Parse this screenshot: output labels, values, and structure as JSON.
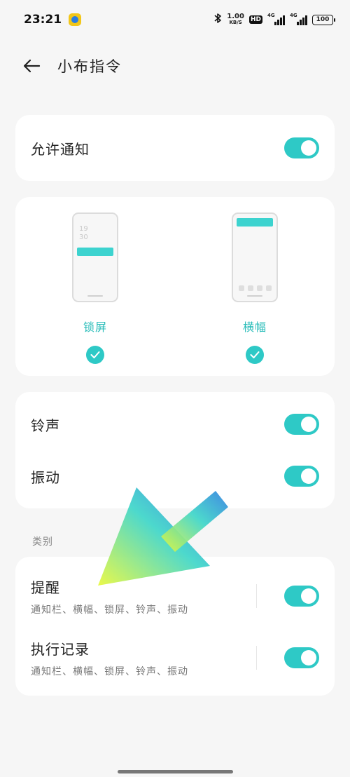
{
  "status_bar": {
    "time": "23:21",
    "net_speed_value": "1.00",
    "net_speed_unit": "KB/S",
    "hd_label": "HD",
    "signal1_tag": "4G",
    "signal2_tag": "4G",
    "battery": "100"
  },
  "header": {
    "title": "小布指令"
  },
  "allow_notifications": {
    "label": "允许通知",
    "enabled": true
  },
  "styles": {
    "lock_screen": {
      "preview_clock_hour": "19",
      "preview_clock_min": "30",
      "label": "锁屏",
      "checked": true
    },
    "banner": {
      "label": "横幅",
      "checked": true
    }
  },
  "sound": {
    "ringtone_label": "铃声",
    "ringtone_enabled": true,
    "vibration_label": "振动",
    "vibration_enabled": true
  },
  "categories": {
    "section_label": "类别",
    "items": [
      {
        "title": "提醒",
        "subtitle": "通知栏、横幅、锁屏、铃声、振动",
        "enabled": true
      },
      {
        "title": "执行记录",
        "subtitle": "通知栏、横幅、锁屏、铃声、振动",
        "enabled": true
      }
    ]
  },
  "colors": {
    "accent": "#2ec9c6",
    "background": "#f6f6f6",
    "card": "#ffffff"
  }
}
